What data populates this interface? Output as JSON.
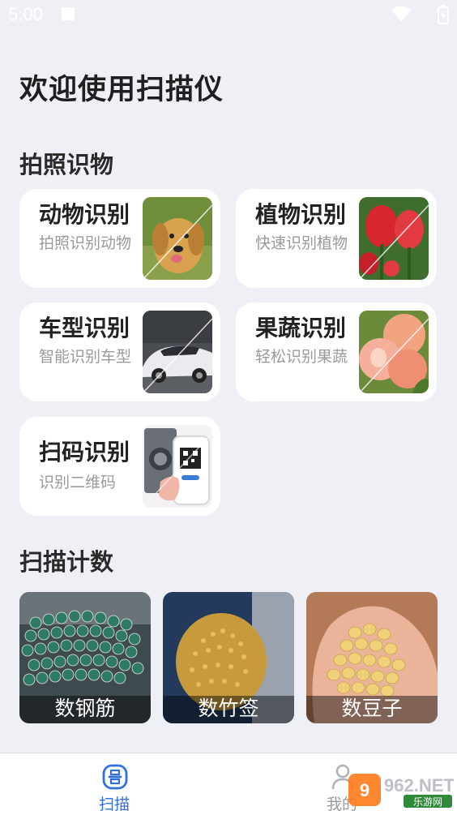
{
  "status_bar": {
    "time": "5:00"
  },
  "header": {
    "title": "欢迎使用扫描仪"
  },
  "recognition": {
    "section_title": "拍照识物",
    "cards": [
      {
        "title": "动物识别",
        "desc": "拍照识别动物",
        "icon": "dog-photo"
      },
      {
        "title": "植物识别",
        "desc": "快速识别植物",
        "icon": "tulip-photo"
      },
      {
        "title": "车型识别",
        "desc": "智能识别车型",
        "icon": "car-photo"
      },
      {
        "title": "果蔬识别",
        "desc": "轻松识别果蔬",
        "icon": "peach-photo"
      },
      {
        "title": "扫码识别",
        "desc": "识别二维码",
        "icon": "qr-phone-photo"
      }
    ]
  },
  "counting": {
    "section_title": "扫描计数",
    "items": [
      {
        "label": "数钢筋",
        "icon": "rebar-photo"
      },
      {
        "label": "数竹签",
        "icon": "skewers-photo"
      },
      {
        "label": "数豆子",
        "icon": "beans-photo"
      }
    ]
  },
  "tabbar": {
    "tabs": [
      {
        "label": "扫描",
        "active": true,
        "icon": "scan-icon"
      },
      {
        "label": "我的",
        "active": false,
        "icon": "user-icon"
      }
    ]
  },
  "watermark": {
    "text": "962.NET",
    "subtext": "乐游网"
  },
  "colors": {
    "accent": "#2f6fe0",
    "background": "#eff0f6",
    "card": "#ffffff"
  }
}
